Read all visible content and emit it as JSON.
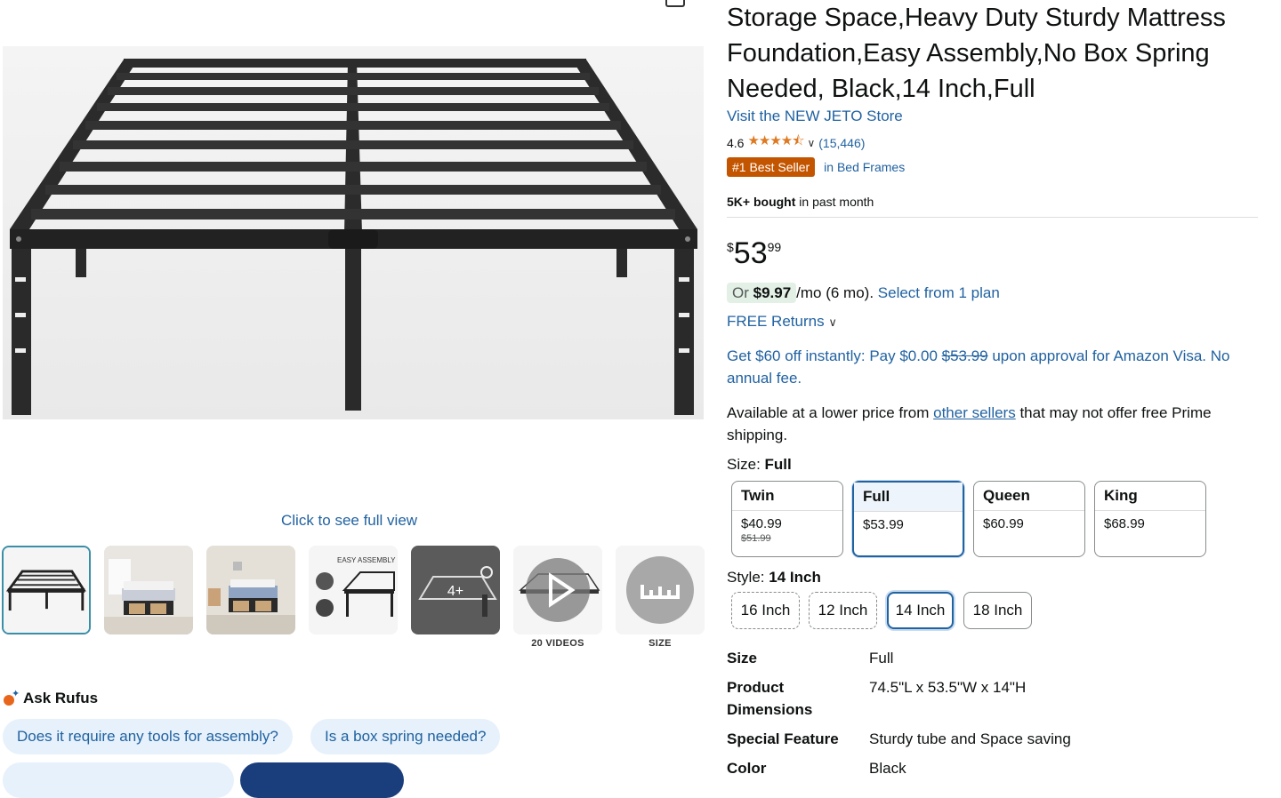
{
  "product": {
    "title": "Storage Space,Heavy Duty Sturdy Mattress Foundation,Easy Assembly,No Box Spring Needed, Black,14 Inch,Full",
    "store_link": "Visit the NEW JETO Store",
    "rating": "4.6",
    "stars": "★★★★⯪",
    "rating_count": "(15,446)",
    "best_seller_badge": "#1 Best Seller",
    "best_seller_category": "in Bed Frames",
    "bought_bold": "5K+ bought",
    "bought_rest": " in past month",
    "price_currency": "$",
    "price_whole": "53",
    "price_fraction": "99"
  },
  "offers": {
    "monthly_prefix": "Or ",
    "monthly_amount": "$9.97",
    "monthly_term": "/mo (6 mo). ",
    "monthly_link": "Select from 1 plan",
    "free_returns": "FREE Returns",
    "visa_part1": "Get $60 off instantly: Pay $0.00 ",
    "visa_struck": "$53.99",
    "visa_part2": " upon approval for Amazon Visa. No annual fee.",
    "avail_part1": "Available at a lower price from ",
    "avail_link": "other sellers",
    "avail_part2": " that may not offer free Prime shipping."
  },
  "size": {
    "label": "Size: ",
    "selected": "Full",
    "options": [
      {
        "name": "Twin",
        "price": "$40.99",
        "was": "$51.99"
      },
      {
        "name": "Full",
        "price": "$53.99",
        "was": ""
      },
      {
        "name": "Queen",
        "price": "$60.99",
        "was": ""
      },
      {
        "name": "King",
        "price": "$68.99",
        "was": ""
      }
    ]
  },
  "style": {
    "label": "Style: ",
    "selected": "14 Inch",
    "options": [
      "16 Inch",
      "12 Inch",
      "14 Inch",
      "18 Inch"
    ]
  },
  "specs": [
    {
      "key": "Size",
      "value": "Full"
    },
    {
      "key": "Product Dimensions",
      "value": "74.5\"L x 53.5\"W x 14\"H"
    },
    {
      "key": "Special Feature",
      "value": "Sturdy tube and Space saving"
    },
    {
      "key": "Color",
      "value": "Black"
    }
  ],
  "gallery": {
    "click_full_view": "Click to see full view",
    "more_overlay": "4+",
    "videos_caption": "20 VIDEOS",
    "size_caption": "SIZE",
    "thumb3_text": "EASY ASSEMBLY"
  },
  "rufus": {
    "title": "Ask Rufus",
    "questions": [
      "Does it require any tools for assembly?",
      "Is a box spring needed?"
    ]
  },
  "colors": {
    "link": "#2162a1",
    "star": "#de7921",
    "best_seller": "#c45500",
    "selected_border": "#2162a1"
  }
}
